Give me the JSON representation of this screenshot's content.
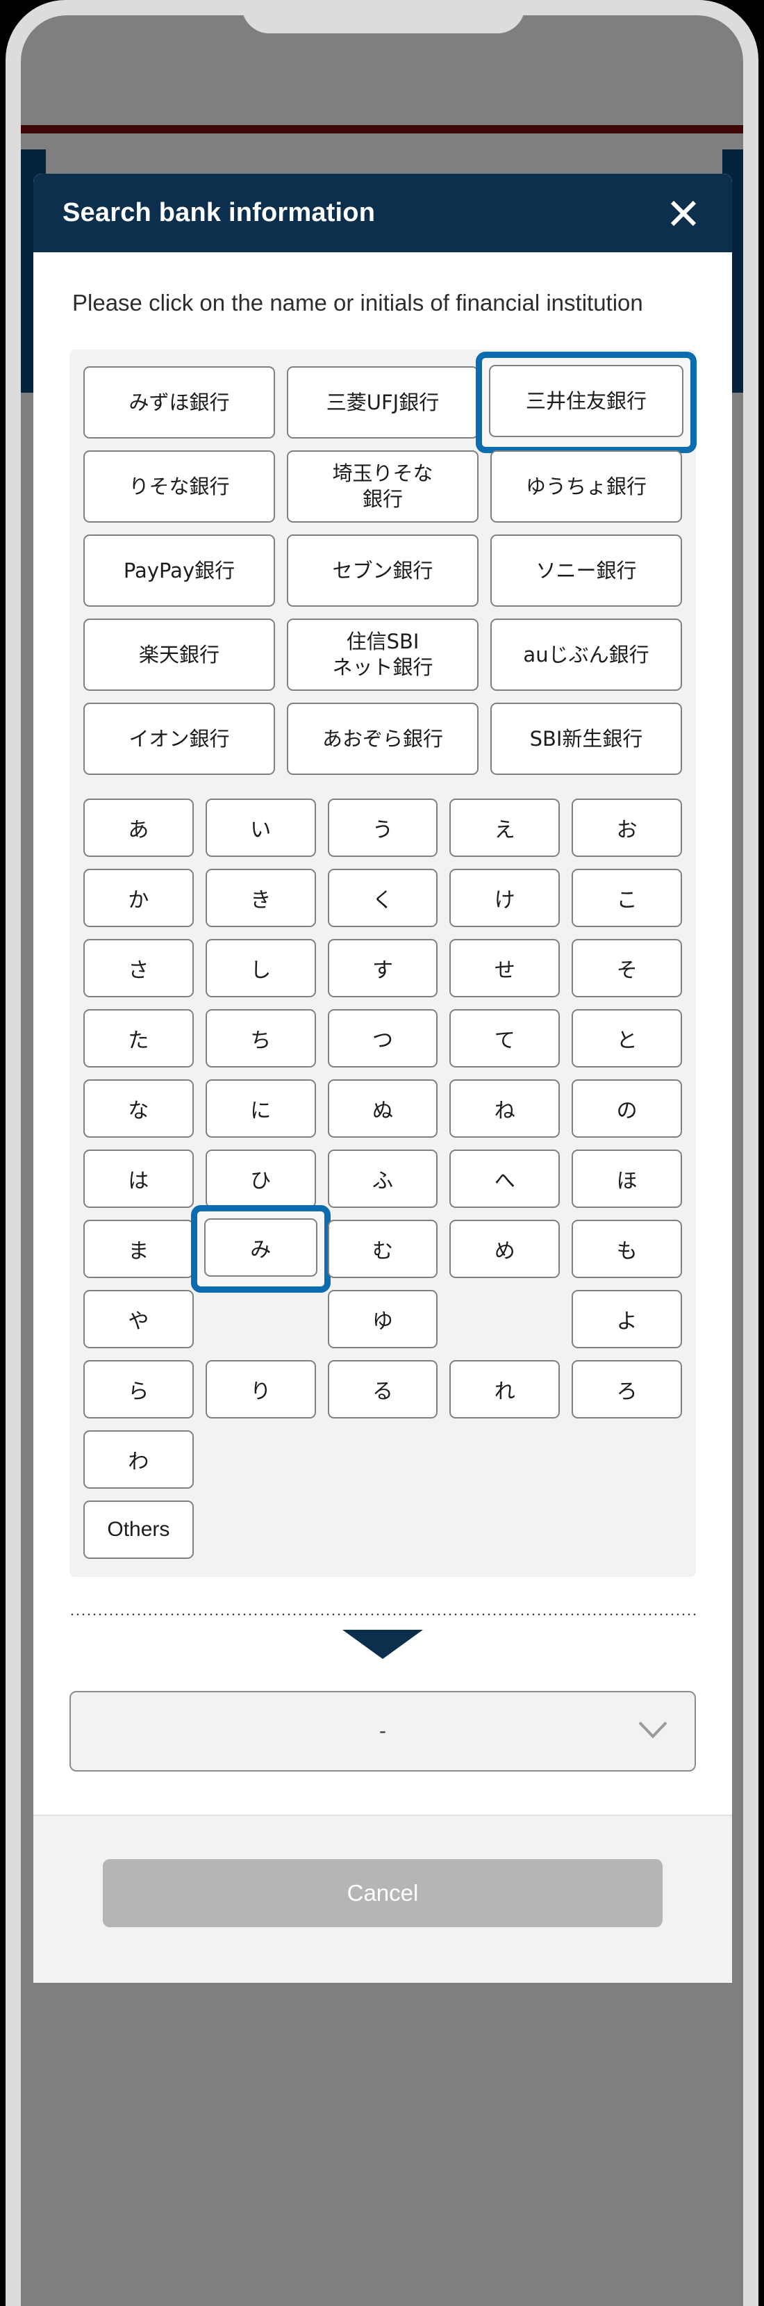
{
  "modal": {
    "title": "Search bank information",
    "close_icon": "close-icon",
    "instruction": "Please click on the name or initials of financial institution",
    "banks": [
      {
        "label": "みずほ銀行",
        "focused": false
      },
      {
        "label": "三菱UFJ銀行",
        "focused": false
      },
      {
        "label": "三井住友銀行",
        "focused": true
      },
      {
        "label": "りそな銀行",
        "focused": false
      },
      {
        "label": "埼玉りそな\n銀行",
        "focused": false
      },
      {
        "label": "ゆうちょ銀行",
        "focused": false
      },
      {
        "label": "PayPay銀行",
        "focused": false
      },
      {
        "label": "セブン銀行",
        "focused": false
      },
      {
        "label": "ソニー銀行",
        "focused": false
      },
      {
        "label": "楽天銀行",
        "focused": false
      },
      {
        "label": "住信SBI\nネット銀行",
        "focused": false
      },
      {
        "label": "auじぶん銀行",
        "focused": false
      },
      {
        "label": "イオン銀行",
        "focused": false
      },
      {
        "label": "あおぞら銀行",
        "focused": false
      },
      {
        "label": "SBI新生銀行",
        "focused": false
      }
    ],
    "kana_rows": [
      [
        {
          "label": "あ",
          "empty": false,
          "focused": false
        },
        {
          "label": "い",
          "empty": false,
          "focused": false
        },
        {
          "label": "う",
          "empty": false,
          "focused": false
        },
        {
          "label": "え",
          "empty": false,
          "focused": false
        },
        {
          "label": "お",
          "empty": false,
          "focused": false
        }
      ],
      [
        {
          "label": "か",
          "empty": false,
          "focused": false
        },
        {
          "label": "き",
          "empty": false,
          "focused": false
        },
        {
          "label": "く",
          "empty": false,
          "focused": false
        },
        {
          "label": "け",
          "empty": false,
          "focused": false
        },
        {
          "label": "こ",
          "empty": false,
          "focused": false
        }
      ],
      [
        {
          "label": "さ",
          "empty": false,
          "focused": false
        },
        {
          "label": "し",
          "empty": false,
          "focused": false
        },
        {
          "label": "す",
          "empty": false,
          "focused": false
        },
        {
          "label": "せ",
          "empty": false,
          "focused": false
        },
        {
          "label": "そ",
          "empty": false,
          "focused": false
        }
      ],
      [
        {
          "label": "た",
          "empty": false,
          "focused": false
        },
        {
          "label": "ち",
          "empty": false,
          "focused": false
        },
        {
          "label": "つ",
          "empty": false,
          "focused": false
        },
        {
          "label": "て",
          "empty": false,
          "focused": false
        },
        {
          "label": "と",
          "empty": false,
          "focused": false
        }
      ],
      [
        {
          "label": "な",
          "empty": false,
          "focused": false
        },
        {
          "label": "に",
          "empty": false,
          "focused": false
        },
        {
          "label": "ぬ",
          "empty": false,
          "focused": false
        },
        {
          "label": "ね",
          "empty": false,
          "focused": false
        },
        {
          "label": "の",
          "empty": false,
          "focused": false
        }
      ],
      [
        {
          "label": "は",
          "empty": false,
          "focused": false
        },
        {
          "label": "ひ",
          "empty": false,
          "focused": false
        },
        {
          "label": "ふ",
          "empty": false,
          "focused": false
        },
        {
          "label": "へ",
          "empty": false,
          "focused": false
        },
        {
          "label": "ほ",
          "empty": false,
          "focused": false
        }
      ],
      [
        {
          "label": "ま",
          "empty": false,
          "focused": false
        },
        {
          "label": "み",
          "empty": false,
          "focused": true
        },
        {
          "label": "む",
          "empty": false,
          "focused": false
        },
        {
          "label": "め",
          "empty": false,
          "focused": false
        },
        {
          "label": "も",
          "empty": false,
          "focused": false
        }
      ],
      [
        {
          "label": "や",
          "empty": false,
          "focused": false
        },
        {
          "label": "",
          "empty": true,
          "focused": false
        },
        {
          "label": "ゆ",
          "empty": false,
          "focused": false
        },
        {
          "label": "",
          "empty": true,
          "focused": false
        },
        {
          "label": "よ",
          "empty": false,
          "focused": false
        }
      ],
      [
        {
          "label": "ら",
          "empty": false,
          "focused": false
        },
        {
          "label": "り",
          "empty": false,
          "focused": false
        },
        {
          "label": "る",
          "empty": false,
          "focused": false
        },
        {
          "label": "れ",
          "empty": false,
          "focused": false
        },
        {
          "label": "ろ",
          "empty": false,
          "focused": false
        }
      ],
      [
        {
          "label": "わ",
          "empty": false,
          "focused": false
        },
        {
          "label": "",
          "empty": true,
          "focused": false
        },
        {
          "label": "",
          "empty": true,
          "focused": false
        },
        {
          "label": "",
          "empty": true,
          "focused": false
        },
        {
          "label": "",
          "empty": true,
          "focused": false
        }
      ]
    ],
    "others_label": "Others",
    "down_arrow_icon": "triangle-down-icon",
    "select": {
      "value": "-",
      "caret_icon": "chevron-down-icon"
    },
    "cancel_label": "Cancel"
  },
  "colors": {
    "header_navy": "#0b2f4d",
    "focus_blue": "#0b6cb0",
    "panel_grey": "#f2f2f2",
    "button_border": "#808080",
    "cancel_grey": "#b5b5b5",
    "page_rule_red": "#7e0c10"
  }
}
